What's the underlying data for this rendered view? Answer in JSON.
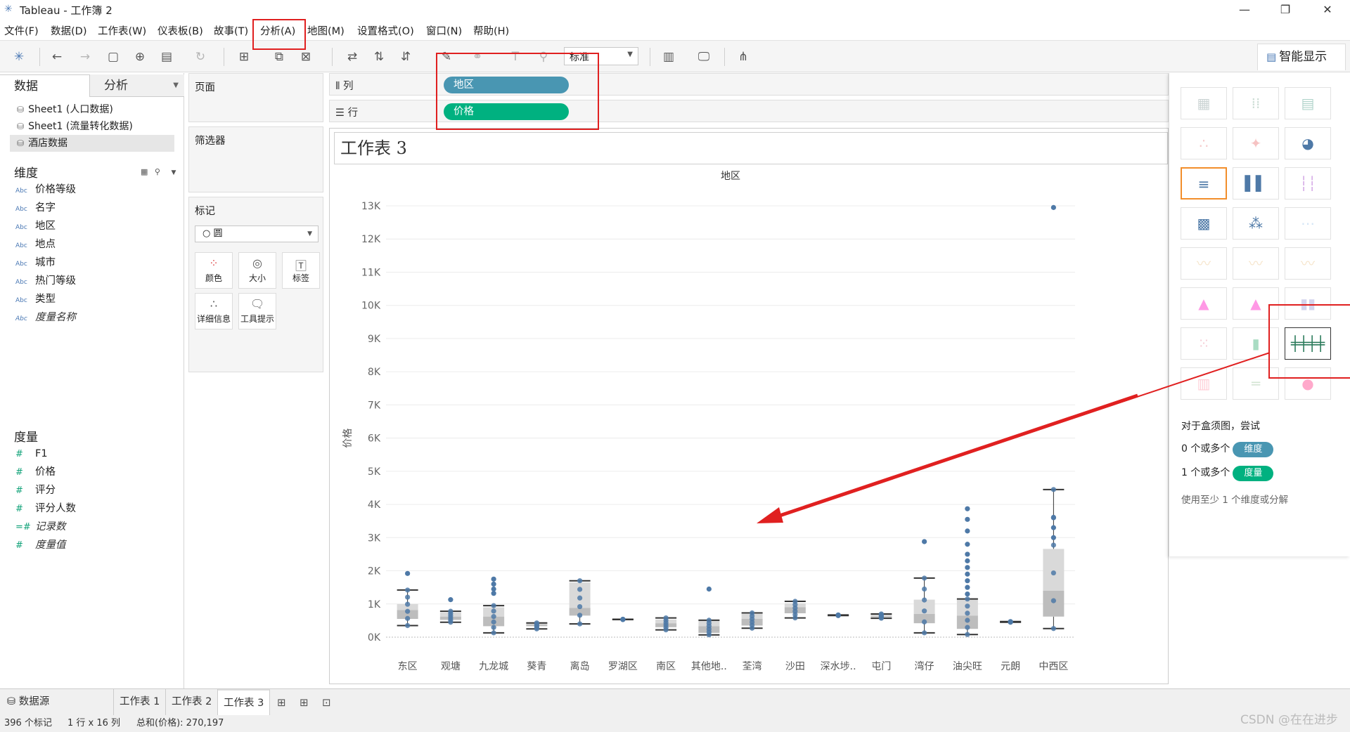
{
  "window": {
    "title": "Tableau - 工作簿 2",
    "minimize": "—",
    "maximize": "❐",
    "close": "✕"
  },
  "menu": [
    "文件(F)",
    "数据(D)",
    "工作表(W)",
    "仪表板(B)",
    "故事(T)",
    "分析(A)",
    "地图(M)",
    "设置格式(O)",
    "窗口(N)",
    "帮助(H)"
  ],
  "toolbar": {
    "fit": "标准",
    "show_me": "智能显示"
  },
  "left_pane": {
    "tabs": [
      "数据",
      "分析"
    ],
    "datasources": [
      "Sheet1 (人口数据)",
      "Sheet1 (流量转化数据)",
      "酒店数据"
    ],
    "dimensions_header": "维度",
    "dimensions": [
      "价格等级",
      "名字",
      "地区",
      "地点",
      "城市",
      "热门等级",
      "类型",
      "度量名称"
    ],
    "dim_type_label": "Abc",
    "measures_header": "度量",
    "measures": [
      "F1",
      "价格",
      "评分",
      "评分人数",
      "记录数",
      "度量值"
    ]
  },
  "cards": {
    "pages": "页面",
    "filters": "筛选器",
    "marks": "标记",
    "mark_type": "○ 圆",
    "mark_buttons": [
      "颜色",
      "大小",
      "标签",
      "详细信息",
      "工具提示"
    ]
  },
  "shelves": {
    "columns_label": "列",
    "rows_label": "行",
    "columns_pill": "地区",
    "rows_pill": "价格"
  },
  "sheet_title": "工作表 3",
  "show_me": {
    "hint_title": "对于盒须图，尝试",
    "hint_dims_prefix": "0 个或多个",
    "hint_dims_pill": "维度",
    "hint_meas_prefix": "1 个或多个",
    "hint_meas_pill": "度量",
    "hint_note": "使用至少 1 个维度或分解"
  },
  "tabs": {
    "datasource": "数据源",
    "sheets": [
      "工作表 1",
      "工作表 2",
      "工作表 3"
    ],
    "active_sheet": "工作表 3"
  },
  "status": {
    "marks": "396 个标记",
    "shape": "1 行 x 16 列",
    "sum": "总和(价格): 270,197"
  },
  "watermark": "CSDN @在在进步",
  "colors": {
    "dimension": "#4996b2",
    "measure": "#00b180",
    "mark": "#4e79a7",
    "annotation": "#e02020"
  },
  "chart_data": {
    "type": "box",
    "title": "地区",
    "xlabel": "地区",
    "ylabel": "价格",
    "ylim": [
      0,
      13000
    ],
    "yticks": [
      "0K",
      "1K",
      "2K",
      "3K",
      "4K",
      "5K",
      "6K",
      "7K",
      "8K",
      "9K",
      "10K",
      "11K",
      "12K",
      "13K"
    ],
    "categories": [
      "东区",
      "观塘",
      "九龙城",
      "葵青",
      "离岛",
      "罗湖区",
      "南区",
      "其他地..",
      "荃湾",
      "沙田",
      "深水埗..",
      "屯门",
      "湾仔",
      "油尖旺",
      "元朗",
      "中西区"
    ],
    "boxes": [
      {
        "min": 350,
        "q1": 550,
        "median": 820,
        "q3": 1000,
        "max": 1420
      },
      {
        "min": 450,
        "q1": 520,
        "median": 620,
        "q3": 740,
        "max": 780
      },
      {
        "min": 130,
        "q1": 330,
        "median": 620,
        "q3": 900,
        "max": 950
      },
      {
        "min": 250,
        "q1": 330,
        "median": 380,
        "q3": 420,
        "max": 430
      },
      {
        "min": 400,
        "q1": 650,
        "median": 880,
        "q3": 1650,
        "max": 1700
      },
      {
        "min": 530,
        "q1": 530,
        "median": 530,
        "q3": 540,
        "max": 540
      },
      {
        "min": 220,
        "q1": 300,
        "median": 420,
        "q3": 530,
        "max": 580
      },
      {
        "min": 70,
        "q1": 130,
        "median": 330,
        "q3": 500,
        "max": 510
      },
      {
        "min": 270,
        "q1": 350,
        "median": 550,
        "q3": 700,
        "max": 730
      },
      {
        "min": 580,
        "q1": 720,
        "median": 900,
        "q3": 1020,
        "max": 1080
      },
      {
        "min": 650,
        "q1": 650,
        "median": 660,
        "q3": 670,
        "max": 670
      },
      {
        "min": 570,
        "q1": 600,
        "median": 630,
        "q3": 690,
        "max": 700
      },
      {
        "min": 130,
        "q1": 420,
        "median": 700,
        "q3": 1130,
        "max": 1780
      },
      {
        "min": 80,
        "q1": 250,
        "median": 650,
        "q3": 1130,
        "max": 1150
      },
      {
        "min": 450,
        "q1": 450,
        "median": 460,
        "q3": 460,
        "max": 470
      },
      {
        "min": 260,
        "q1": 620,
        "median": 1400,
        "q3": 2660,
        "max": 4450
      }
    ],
    "outliers": [
      {
        "category": "东区",
        "values": [
          1920
        ]
      },
      {
        "category": "观塘",
        "values": [
          1130
        ]
      },
      {
        "category": "九龙城",
        "values": [
          1320,
          1450,
          1600,
          1750
        ]
      },
      {
        "category": "其他地..",
        "values": [
          1450
        ]
      },
      {
        "category": "湾仔",
        "values": [
          2880
        ]
      },
      {
        "category": "油尖旺",
        "values": [
          1300,
          1500,
          1700,
          1900,
          2100,
          2300,
          2500,
          2800,
          3200,
          3550,
          3870
        ]
      },
      {
        "category": "中西区",
        "values": [
          3000,
          3300,
          3600,
          12950
        ]
      }
    ]
  }
}
